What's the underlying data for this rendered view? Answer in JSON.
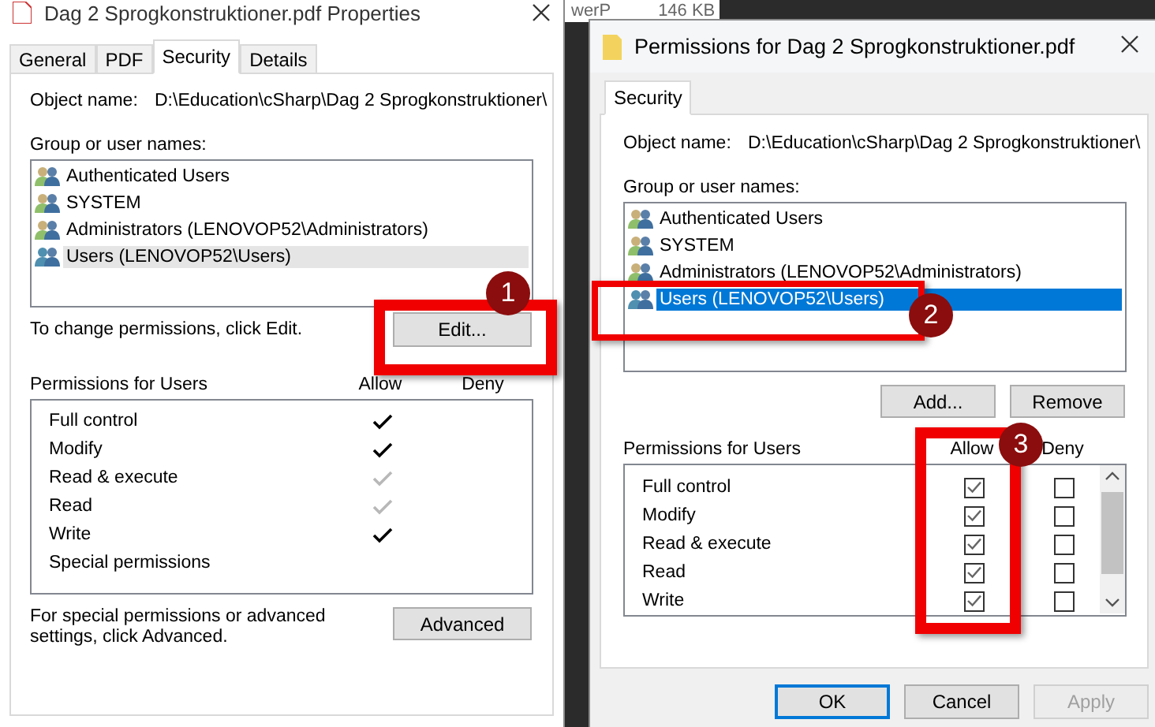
{
  "background_window": {
    "texts": [
      "werP",
      "146 KB"
    ]
  },
  "properties_dialog": {
    "title": "Dag 2 Sprogkonstruktioner.pdf Properties",
    "tabs": [
      {
        "label": "General",
        "selected": false
      },
      {
        "label": "PDF",
        "selected": false
      },
      {
        "label": "Security",
        "selected": true
      },
      {
        "label": "Details",
        "selected": false
      }
    ],
    "object_name_label": "Object name:",
    "object_name": "D:\\Education\\cSharp\\Dag 2 Sprogkonstruktioner\\",
    "group_label": "Group or user names:",
    "users": [
      {
        "name": "Authenticated Users",
        "selected": false
      },
      {
        "name": "SYSTEM",
        "selected": false
      },
      {
        "name": "Administrators (LENOVOP52\\Administrators)",
        "selected": false
      },
      {
        "name": "Users (LENOVOP52\\Users)",
        "selected": true
      }
    ],
    "edit_hint": "To change permissions, click Edit.",
    "edit_button": "Edit...",
    "permissions_label": "Permissions for Users",
    "allow_header": "Allow",
    "deny_header": "Deny",
    "permissions": [
      {
        "name": "Full control",
        "allow": true,
        "inherited": false
      },
      {
        "name": "Modify",
        "allow": true,
        "inherited": false
      },
      {
        "name": "Read & execute",
        "allow": true,
        "inherited": true
      },
      {
        "name": "Read",
        "allow": true,
        "inherited": true
      },
      {
        "name": "Write",
        "allow": true,
        "inherited": false
      },
      {
        "name": "Special permissions",
        "allow": false
      }
    ],
    "advanced_hint": "For special permissions or advanced settings, click Advanced.",
    "advanced_button": "Advanced"
  },
  "permissions_dialog": {
    "title": "Permissions for Dag 2 Sprogkonstruktioner.pdf",
    "tabs": [
      {
        "label": "Security",
        "selected": true
      }
    ],
    "object_name_label": "Object name:",
    "object_name": "D:\\Education\\cSharp\\Dag 2 Sprogkonstruktioner\\",
    "group_label": "Group or user names:",
    "users": [
      {
        "name": "Authenticated Users",
        "selected": false
      },
      {
        "name": "SYSTEM",
        "selected": false
      },
      {
        "name": "Administrators (LENOVOP52\\Administrators)",
        "selected": false
      },
      {
        "name": "Users (LENOVOP52\\Users)",
        "selected": true
      }
    ],
    "add_button": "Add...",
    "remove_button": "Remove",
    "permissions_label": "Permissions for Users",
    "allow_header": "Allow",
    "deny_header": "Deny",
    "permissions": [
      {
        "name": "Full control",
        "allow": true,
        "deny": false
      },
      {
        "name": "Modify",
        "allow": true,
        "deny": false
      },
      {
        "name": "Read & execute",
        "allow": true,
        "deny": false
      },
      {
        "name": "Read",
        "allow": true,
        "deny": false
      },
      {
        "name": "Write",
        "allow": true,
        "deny": false
      }
    ],
    "buttons": [
      {
        "label": "OK",
        "kind": "default",
        "disabled": false
      },
      {
        "label": "Cancel",
        "kind": "normal",
        "disabled": false
      },
      {
        "label": "Apply",
        "kind": "normal",
        "disabled": true
      }
    ]
  },
  "annotations": [
    {
      "number": "1"
    },
    {
      "number": "2"
    },
    {
      "number": "3"
    }
  ]
}
